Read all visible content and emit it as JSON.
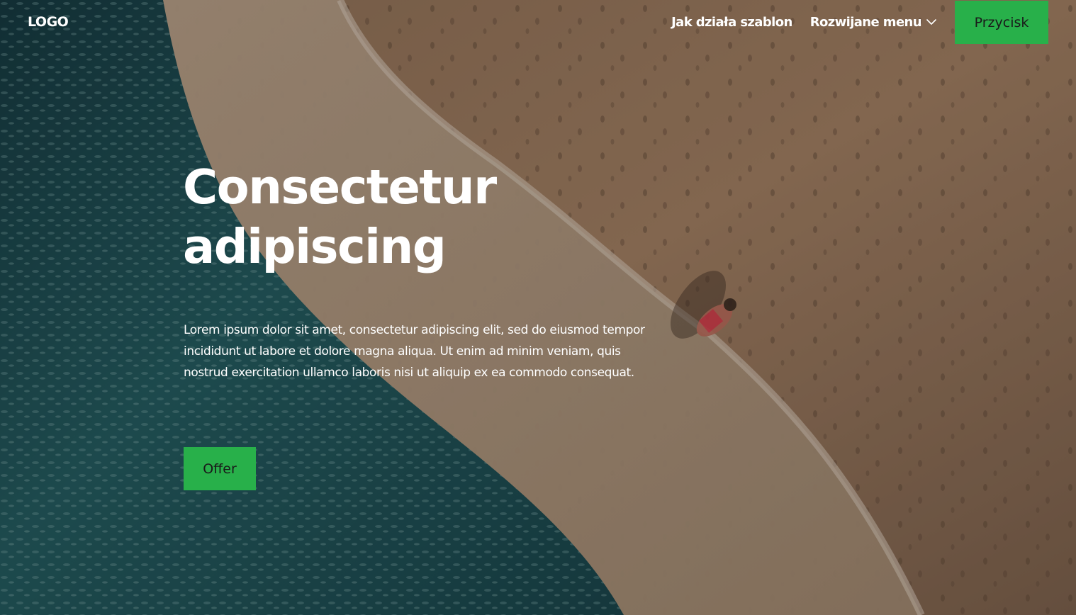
{
  "header": {
    "logo": "LOGO",
    "nav": {
      "link_1": "Jak działa szablon",
      "dropdown_label": "Rozwijane menu",
      "button_label": "Przycisk"
    }
  },
  "hero": {
    "headline_line_1": "Consectetur",
    "headline_line_2": "adipiscing",
    "lead": "Lorem ipsum dolor sit amet, consectetur adipiscing elit, sed do eiusmod tempor incididunt ut labore et dolore magna aliqua. Ut enim ad minim veniam, quis nostrud exercitation ullamco laboris nisi ut aliquip ex ea commodo consequat.",
    "cta_label": "Offer"
  },
  "colors": {
    "accent": "#28b04a",
    "text": "#ffffff",
    "button_text": "#1a1a1a",
    "sea": "#1f4f55",
    "sand": "#a48062"
  },
  "icons": {
    "dropdown": "chevron-down-icon"
  }
}
